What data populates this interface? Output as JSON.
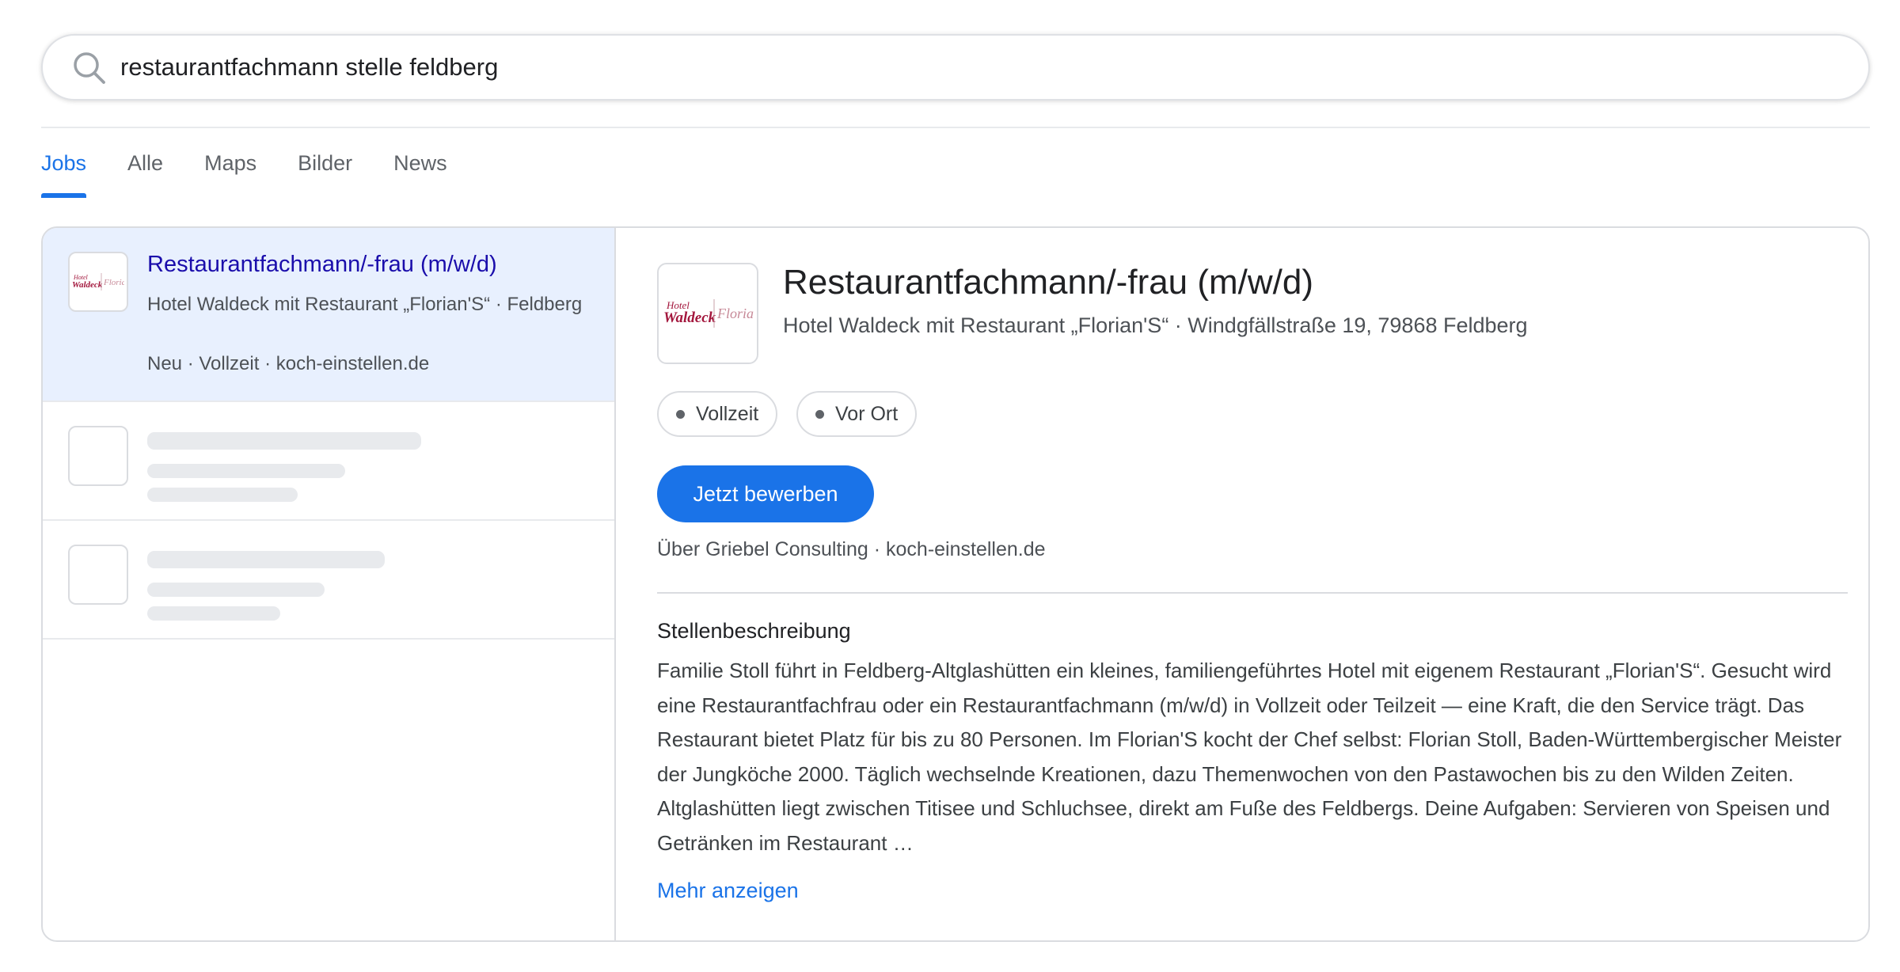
{
  "search": {
    "query": "restaurantfachmann stelle feldberg",
    "icon": "search-icon"
  },
  "tabs": [
    {
      "label": "Jobs",
      "active": true
    },
    {
      "label": "Alle",
      "active": false
    },
    {
      "label": "Maps",
      "active": false
    },
    {
      "label": "Bilder",
      "active": false
    },
    {
      "label": "News",
      "active": false
    }
  ],
  "colors": {
    "accent": "#1a73e8",
    "link": "#1a0dab",
    "selected_bg": "#e8f0fe",
    "logo_brand": "#a3173d"
  },
  "job_list": {
    "selected": {
      "title": "Restaurantfachmann/-frau (m/w/d)",
      "company": "Hotel Waldeck mit Restaurant „Florian'S“ · Feldberg",
      "meta": "Neu · Vollzeit · koch-einstellen.de"
    }
  },
  "detail": {
    "title": "Restaurantfachmann/-frau (m/w/d)",
    "company_address": "Hotel Waldeck mit Restaurant „Florian'S“ · Windgfällstraße 19, 79868 Feldberg",
    "chips": [
      "Vollzeit",
      "Vor Ort"
    ],
    "apply_label": "Jetzt bewerben",
    "via": "Über Griebel Consulting · koch-einstellen.de",
    "description_heading": "Stellenbeschreibung",
    "description": "Familie Stoll führt in Feldberg-Altglashütten ein kleines, familiengeführtes Hotel mit eigenem Restaurant „Florian'S“. Gesucht wird eine Restaurantfachfrau oder ein Restaurantfachmann (m/w/d) in Vollzeit oder Teilzeit — eine Kraft, die den Service trägt. Das Restaurant bietet Platz für bis zu 80 Personen. Im Florian'S kocht der Chef selbst: Florian Stoll, Baden-Württembergischer Meister der Jungköche 2000. Täglich wechselnde Kreationen, dazu Themenwochen von den Pastawochen bis zu den Wilden Zeiten. Altglashütten liegt zwischen Titisee und Schluchsee, direkt am Fuße des Feldbergs. Deine Aufgaben: Servieren von Speisen und Getränken im Restaurant …",
    "more_label": "Mehr anzeigen"
  }
}
